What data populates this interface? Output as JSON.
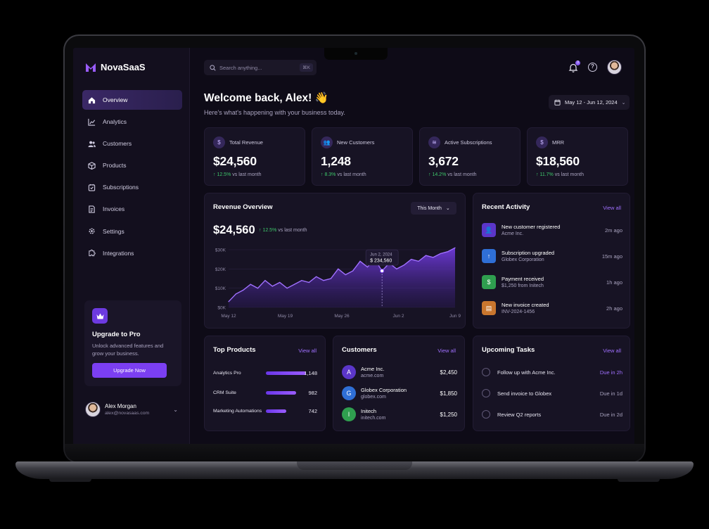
{
  "brand": {
    "name": "NovaSaaS"
  },
  "sidebar": {
    "items": [
      {
        "label": "Overview",
        "icon": "home-icon",
        "active": true
      },
      {
        "label": "Analytics",
        "icon": "chart-icon"
      },
      {
        "label": "Customers",
        "icon": "users-icon"
      },
      {
        "label": "Products",
        "icon": "box-icon"
      },
      {
        "label": "Subscriptions",
        "icon": "subscription-icon"
      },
      {
        "label": "Invoices",
        "icon": "invoice-icon"
      },
      {
        "label": "Settings",
        "icon": "gear-icon"
      },
      {
        "label": "Integrations",
        "icon": "puzzle-icon"
      }
    ],
    "upgrade": {
      "title": "Upgrade to Pro",
      "description": "Unlock advanced features and grow your business.",
      "button": "Upgrade Now"
    },
    "user": {
      "name": "Alex Morgan",
      "email": "alex@novasaas.com"
    }
  },
  "topbar": {
    "search_placeholder": "Search anything...",
    "shortcut": "⌘K",
    "notification_count": "3"
  },
  "header": {
    "welcome": "Welcome back, Alex! 👋",
    "subtitle": "Here's what's happening with your business today.",
    "date_range": "May 12 - Jun 12, 2024"
  },
  "stats": [
    {
      "label": "Total Revenue",
      "value": "$24,560",
      "change": "12.5%",
      "suffix": "vs last month",
      "icon": "dollar-icon"
    },
    {
      "label": "New Customers",
      "value": "1,248",
      "change": "8.3%",
      "suffix": "vs last month",
      "icon": "users-icon"
    },
    {
      "label": "Active Subscriptions",
      "value": "3,672",
      "change": "14.2%",
      "suffix": "vs last month",
      "icon": "layers-icon"
    },
    {
      "label": "MRR",
      "value": "$18,560",
      "change": "11.7%",
      "suffix": "vs last month",
      "icon": "dollar-icon"
    }
  ],
  "revenue": {
    "title": "Revenue Overview",
    "period": "This Month",
    "total": "$24,560",
    "change": "12.5%",
    "suffix": "vs last month",
    "tooltip_date": "Jun 2, 2024",
    "tooltip_value": "$ 234,560"
  },
  "chart_data": {
    "type": "area",
    "title": "Revenue Overview",
    "x_tick_labels": [
      "May 12",
      "May 19",
      "May 26",
      "Jun 2",
      "Jun 9"
    ],
    "y_tick_labels": [
      "$0K",
      "$10K",
      "$20K",
      "$30K"
    ],
    "ylim": [
      0,
      30
    ],
    "y_unit": "$K",
    "x": [
      "May 12",
      "May 13",
      "May 14",
      "May 15",
      "May 16",
      "May 17",
      "May 18",
      "May 19",
      "May 20",
      "May 21",
      "May 22",
      "May 23",
      "May 24",
      "May 25",
      "May 26",
      "May 27",
      "May 28",
      "May 29",
      "May 30",
      "May 31",
      "Jun 1",
      "Jun 2",
      "Jun 3",
      "Jun 4",
      "Jun 5",
      "Jun 6",
      "Jun 7",
      "Jun 8",
      "Jun 9",
      "Jun 10",
      "Jun 11",
      "Jun 12"
    ],
    "values": [
      3,
      7,
      9,
      12,
      10,
      14,
      11,
      13,
      10,
      12,
      14,
      13,
      16,
      14,
      15,
      20,
      17,
      19,
      24,
      21,
      25,
      19,
      23,
      20,
      22,
      25,
      24,
      27,
      26,
      28,
      29,
      31
    ],
    "highlight_index": 21,
    "grid": true
  },
  "activity": {
    "title": "Recent Activity",
    "view_all": "View all",
    "items": [
      {
        "title": "New customer registered",
        "detail": "Acme Inc.",
        "time": "2m ago",
        "icon": "user-plus-icon",
        "color": "#5b36c9"
      },
      {
        "title": "Subscription upgraded",
        "detail": "Globex Corporation",
        "time": "15m ago",
        "icon": "arrow-up-icon",
        "color": "#2f6fd6"
      },
      {
        "title": "Payment received",
        "detail": "$1,250 from Initech",
        "time": "1h ago",
        "icon": "dollar-icon",
        "color": "#2f9e4f"
      },
      {
        "title": "New invoice created",
        "detail": "INV-2024-1456",
        "time": "2h ago",
        "icon": "document-icon",
        "color": "#c9762e"
      }
    ]
  },
  "products": {
    "title": "Top Products",
    "view_all": "View all",
    "items": [
      {
        "name": "Analytics Pro",
        "value": "1,148",
        "share": 0.95
      },
      {
        "name": "CRM Suite",
        "value": "982",
        "share": 0.72
      },
      {
        "name": "Marketing Automations",
        "value": "742",
        "share": 0.48
      }
    ]
  },
  "customers": {
    "title": "Customers",
    "view_all": "View all",
    "items": [
      {
        "initial": "A",
        "name": "Acme Inc.",
        "domain": "acme.com",
        "amount": "$2,450",
        "color": "#5b36c9"
      },
      {
        "initial": "G",
        "name": "Globex Corporation",
        "domain": "globex.com",
        "amount": "$1,850",
        "color": "#2f6fd6"
      },
      {
        "initial": "I",
        "name": "Initech",
        "domain": "initech.com",
        "amount": "$1,250",
        "color": "#2f9e4f"
      }
    ]
  },
  "tasks": {
    "title": "Upcoming Tasks",
    "view_all": "View all",
    "items": [
      {
        "label": "Follow up with Acme Inc.",
        "due": "Due in 2h",
        "urgent": true
      },
      {
        "label": "Send invoice to Globex",
        "due": "Due in 1d",
        "urgent": false
      },
      {
        "label": "Review Q2 reports",
        "due": "Due in 2d",
        "urgent": false
      }
    ]
  },
  "colors": {
    "accent": "#7b3ff2",
    "positive": "#3ec76b",
    "background": "#0e0b17",
    "card": "#171324"
  }
}
